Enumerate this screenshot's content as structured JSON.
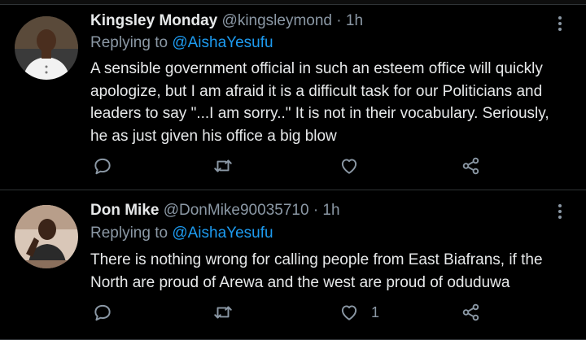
{
  "tweets": [
    {
      "author": {
        "name": "Kingsley Monday",
        "handle": "@kingsleymond"
      },
      "separator": "·",
      "time": "1h",
      "replying_prefix": "Replying to",
      "replying_to": "@AishaYesufu",
      "text": "A sensible government  official in such an esteem office will quickly apologize, but I am afraid it is a difficult task for our Politicians and leaders to say \"...I am sorry..\" It is not in their vocabulary. Seriously, he as just given his office a big blow",
      "actions": {
        "reply_icon": "reply-icon",
        "retweet_icon": "retweet-icon",
        "like_icon": "heart-icon",
        "like_count": "",
        "share_icon": "share-icon"
      }
    },
    {
      "author": {
        "name": "Don Mike",
        "handle": "@DonMike90035710"
      },
      "separator": "·",
      "time": "1h",
      "replying_prefix": "Replying to",
      "replying_to": "@AishaYesufu",
      "text": "There is nothing wrong for calling people from East Biafrans, if the North are proud of Arewa and the west are proud of oduduwa",
      "actions": {
        "reply_icon": "reply-icon",
        "retweet_icon": "retweet-icon",
        "like_icon": "heart-icon",
        "like_count": "1",
        "share_icon": "share-icon"
      }
    }
  ],
  "colors": {
    "background": "#000000",
    "text": "#e7e9ea",
    "secondary_text": "#8b98a5",
    "link": "#1d9bf0",
    "divider": "#2f3336"
  }
}
